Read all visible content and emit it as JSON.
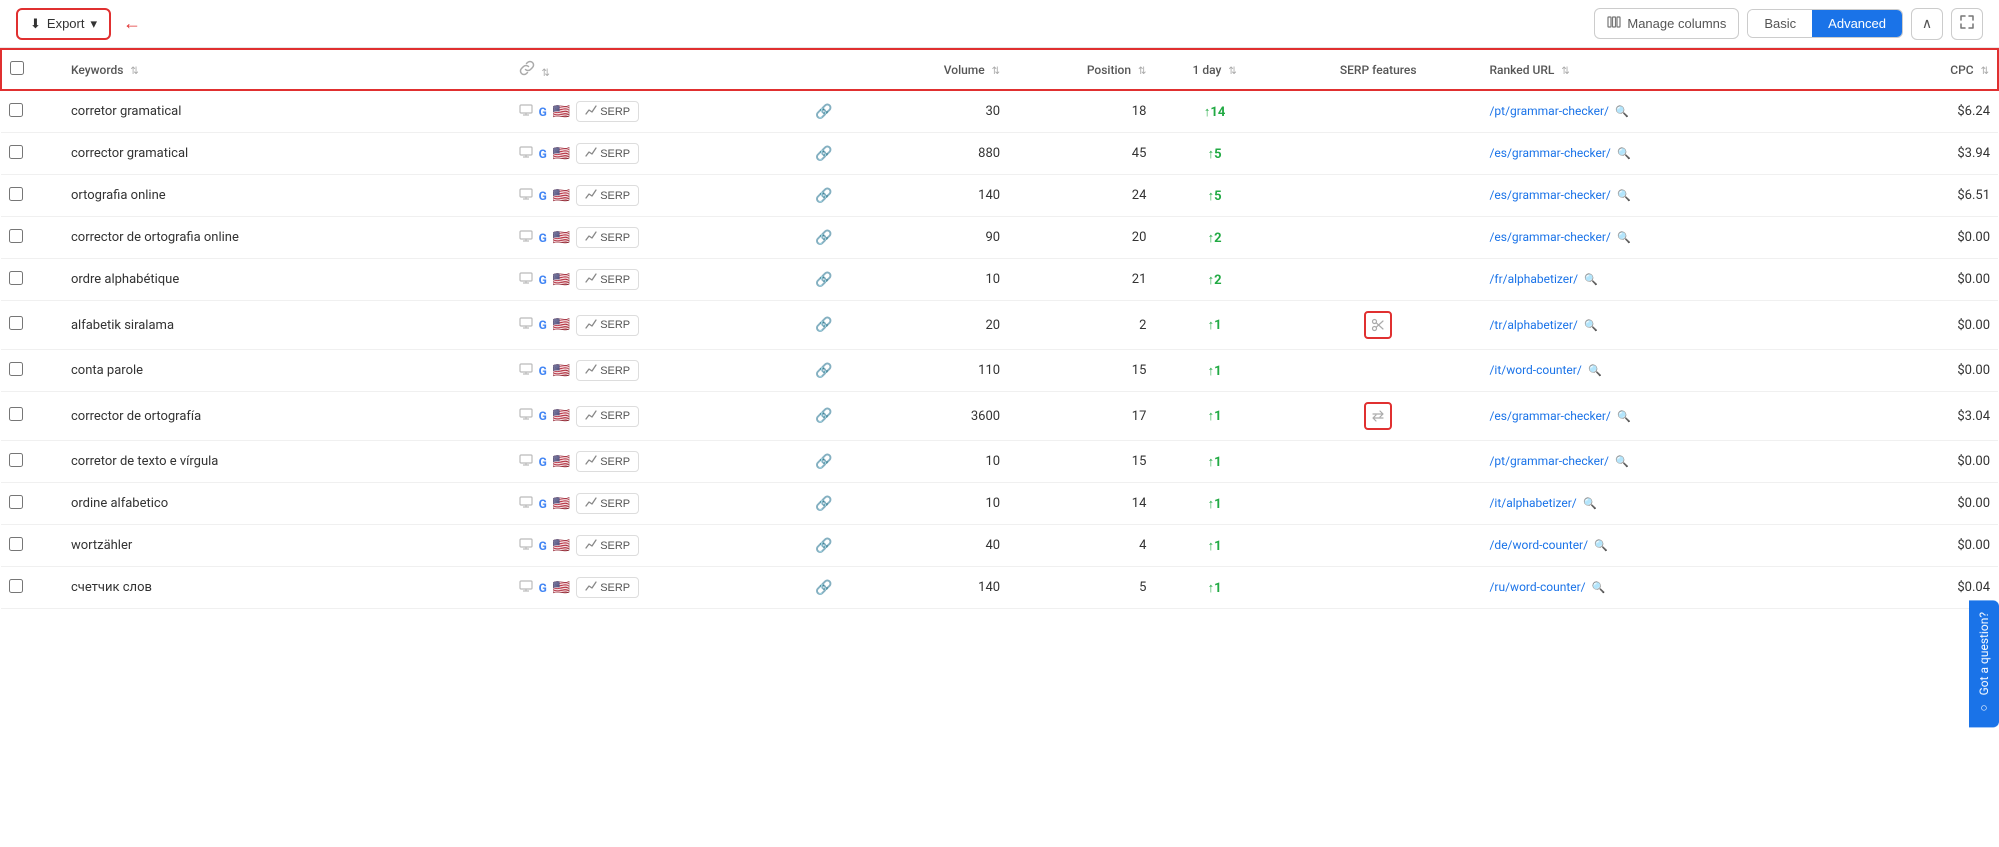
{
  "toolbar": {
    "export_label": "Export",
    "manage_columns_label": "Manage columns",
    "view_basic_label": "Basic",
    "view_advanced_label": "Advanced"
  },
  "table": {
    "columns": {
      "keywords": "Keywords",
      "volume": "Volume",
      "position": "Position",
      "oneday": "1 day",
      "serp_features": "SERP features",
      "ranked_url": "Ranked URL",
      "cpc": "CPC"
    },
    "rows": [
      {
        "keyword": "corretor gramatical",
        "volume": "30",
        "position": "18",
        "oneday": "14",
        "oneday_dir": "up",
        "serp_icon": null,
        "url": "/pt/grammar-checker/",
        "cpc": "$6.24"
      },
      {
        "keyword": "corrector gramatical",
        "volume": "880",
        "position": "45",
        "oneday": "5",
        "oneday_dir": "up",
        "serp_icon": null,
        "url": "/es/grammar-checker/",
        "cpc": "$3.94"
      },
      {
        "keyword": "ortografia online",
        "volume": "140",
        "position": "24",
        "oneday": "5",
        "oneday_dir": "up",
        "serp_icon": null,
        "url": "/es/grammar-checker/",
        "cpc": "$6.51"
      },
      {
        "keyword": "corrector de ortografia online",
        "volume": "90",
        "position": "20",
        "oneday": "2",
        "oneday_dir": "up",
        "serp_icon": null,
        "url": "/es/grammar-checker/",
        "cpc": "$0.00"
      },
      {
        "keyword": "ordre alphabétique",
        "volume": "10",
        "position": "21",
        "oneday": "2",
        "oneday_dir": "up",
        "serp_icon": null,
        "url": "/fr/alphabetizer/",
        "cpc": "$0.00"
      },
      {
        "keyword": "alfabetik siralama",
        "volume": "20",
        "position": "2",
        "oneday": "1",
        "oneday_dir": "up",
        "serp_icon": "scissors",
        "url": "/tr/alphabetizer/",
        "cpc": "$0.00"
      },
      {
        "keyword": "conta parole",
        "volume": "110",
        "position": "15",
        "oneday": "1",
        "oneday_dir": "up",
        "serp_icon": null,
        "url": "/it/word-counter/",
        "cpc": "$0.00"
      },
      {
        "keyword": "corrector de ortografía",
        "volume": "3600",
        "position": "17",
        "oneday": "1",
        "oneday_dir": "up",
        "serp_icon": "transfer",
        "url": "/es/grammar-checker/",
        "cpc": "$3.04"
      },
      {
        "keyword": "corretor de texto e vírgula",
        "volume": "10",
        "position": "15",
        "oneday": "1",
        "oneday_dir": "up",
        "serp_icon": null,
        "url": "/pt/grammar-checker/",
        "cpc": "$0.00"
      },
      {
        "keyword": "ordine alfabetico",
        "volume": "10",
        "position": "14",
        "oneday": "1",
        "oneday_dir": "up",
        "serp_icon": null,
        "url": "/it/alphabetizer/",
        "cpc": "$0.00"
      },
      {
        "keyword": "wortzähler",
        "volume": "40",
        "position": "4",
        "oneday": "1",
        "oneday_dir": "up",
        "serp_icon": null,
        "url": "/de/word-counter/",
        "cpc": "$0.00"
      },
      {
        "keyword": "счетчик слов",
        "volume": "140",
        "position": "5",
        "oneday": "1",
        "oneday_dir": "up",
        "serp_icon": null,
        "url": "/ru/word-counter/",
        "cpc": "$0.04"
      }
    ]
  },
  "got_question": "Got a question?"
}
